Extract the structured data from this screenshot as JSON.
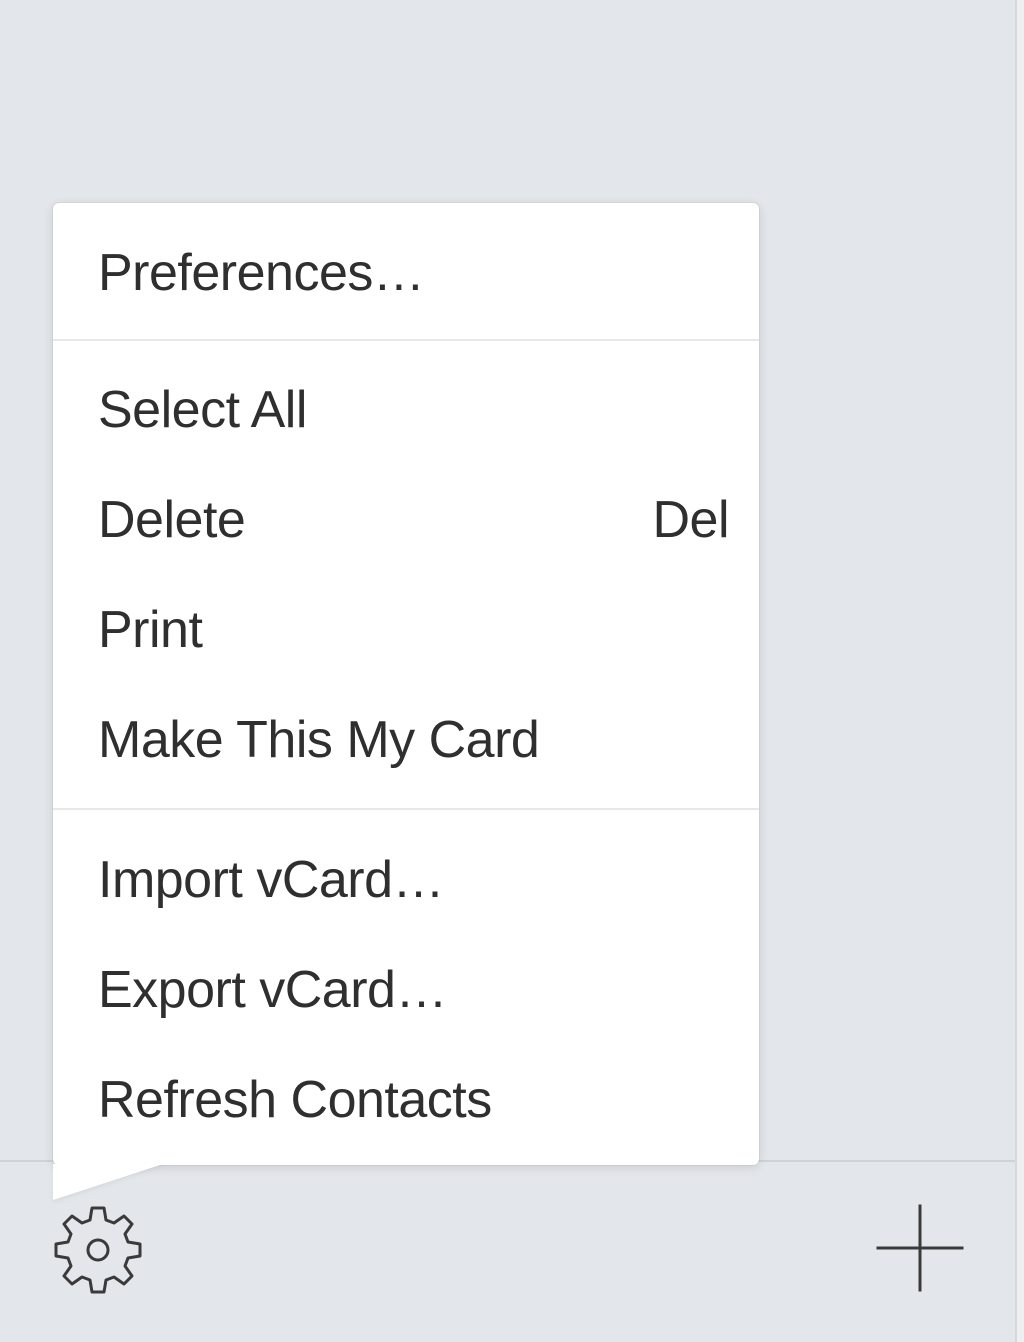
{
  "menu": {
    "items": [
      {
        "label": "Preferences…",
        "shortcut": ""
      },
      {
        "label": "Select All",
        "shortcut": ""
      },
      {
        "label": "Delete",
        "shortcut": "Del"
      },
      {
        "label": "Print",
        "shortcut": ""
      },
      {
        "label": "Make This My Card",
        "shortcut": ""
      },
      {
        "label": "Import vCard…",
        "shortcut": ""
      },
      {
        "label": "Export vCard…",
        "shortcut": ""
      },
      {
        "label": "Refresh Contacts",
        "shortcut": ""
      }
    ]
  },
  "toolbar": {
    "settings_icon": "gear-icon",
    "add_icon": "plus-icon"
  },
  "colors": {
    "background": "#e3e6ea",
    "menu_background": "#ffffff",
    "text": "#2f2f2f",
    "icon": "#3a3a3a"
  }
}
